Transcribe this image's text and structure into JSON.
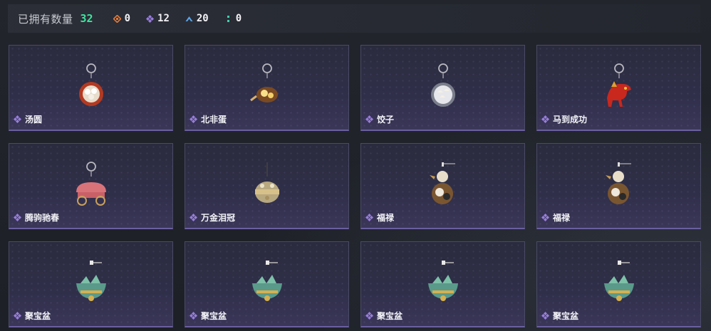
{
  "header": {
    "owned_label": "已拥有数量",
    "owned_count": "32",
    "stats": [
      {
        "icon": "orange-diamond-icon",
        "color": "#e07a3c",
        "value": "0"
      },
      {
        "icon": "purple-diamond-icon",
        "color": "#9a7de0",
        "value": "12"
      },
      {
        "icon": "blue-wing-icon",
        "color": "#5aa6e8",
        "value": "20"
      },
      {
        "icon": "teal-dots-icon",
        "color": "#3fd0b0",
        "value": "0"
      }
    ]
  },
  "items": [
    {
      "name": "汤圆",
      "rarity": "purple",
      "art": "bowl-red"
    },
    {
      "name": "北非蛋",
      "rarity": "purple",
      "art": "pan"
    },
    {
      "name": "饺子",
      "rarity": "purple",
      "art": "plate"
    },
    {
      "name": "马到成功",
      "rarity": "purple",
      "art": "horse"
    },
    {
      "name": "腾驹驰春",
      "rarity": "purple",
      "art": "carriage"
    },
    {
      "name": "万金泪冠",
      "rarity": "purple",
      "art": "crown"
    },
    {
      "name": "福禄",
      "rarity": "purple",
      "art": "gourd"
    },
    {
      "name": "福禄",
      "rarity": "purple",
      "art": "gourd"
    },
    {
      "name": "聚宝盆",
      "rarity": "purple",
      "art": "treasure"
    },
    {
      "name": "聚宝盆",
      "rarity": "purple",
      "art": "treasure"
    },
    {
      "name": "聚宝盆",
      "rarity": "purple",
      "art": "treasure"
    },
    {
      "name": "聚宝盆",
      "rarity": "purple",
      "art": "treasure"
    }
  ]
}
